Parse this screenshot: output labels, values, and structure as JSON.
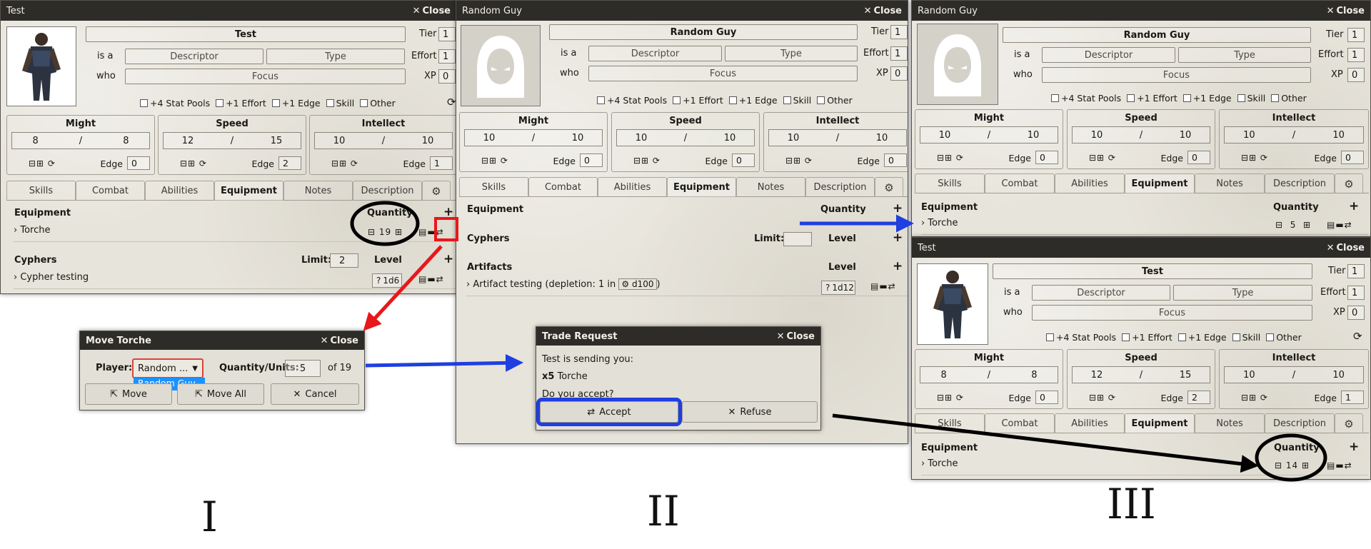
{
  "left_sheet": {
    "title": "Test",
    "close_label": "Close",
    "name": "Test",
    "tier_label": "Tier",
    "tier": "1",
    "effort_label": "Effort",
    "effort": "1",
    "xp_label": "XP",
    "xp": "0",
    "is_a_label": "is a",
    "who_label": "who",
    "descriptor": "Descriptor",
    "type": "Type",
    "focus": "Focus",
    "checks": [
      "+4 Stat Pools",
      "+1 Effort",
      "+1 Edge",
      "Skill",
      "Other"
    ],
    "pools": [
      {
        "name": "Might",
        "value": "8",
        "max": "8",
        "edge": "0"
      },
      {
        "name": "Speed",
        "value": "12",
        "max": "15",
        "edge": "2"
      },
      {
        "name": "Intellect",
        "value": "10",
        "max": "10",
        "edge": "1"
      }
    ],
    "edge_label": "Edge",
    "slash": "/",
    "tabs": [
      "Skills",
      "Combat",
      "Abilities",
      "Equipment",
      "Notes",
      "Description"
    ],
    "equipment_label": "Equipment",
    "quantity_label": "Quantity",
    "item": "Torche",
    "item_qty": "19",
    "cyphers_label": "Cyphers",
    "limit_label": "Limit:",
    "limit_value": "2",
    "level_label": "Level",
    "cypher_item": "Cypher testing",
    "cypher_level": "1d6"
  },
  "move_dialog": {
    "title": "Move Torche",
    "close_label": "Close",
    "player_label": "Player:",
    "player_value": "Random ...",
    "player_option": "Random Guy",
    "qty_label": "Quantity/Units:",
    "qty_value": "5",
    "of_label": "of 19",
    "move_label": "Move",
    "move_all_label": "Move All",
    "cancel_label": "Cancel"
  },
  "middle_sheet": {
    "title": "Random Guy",
    "close_label": "Close",
    "name": "Random Guy",
    "tier_label": "Tier",
    "tier": "1",
    "effort_label": "Effort",
    "effort": "1",
    "xp_label": "XP",
    "xp": "0",
    "is_a_label": "is a",
    "who_label": "who",
    "descriptor": "Descriptor",
    "type": "Type",
    "focus": "Focus",
    "checks": [
      "+4 Stat Pools",
      "+1 Effort",
      "+1 Edge",
      "Skill",
      "Other"
    ],
    "pools": [
      {
        "name": "Might",
        "value": "10",
        "max": "10",
        "edge": "0"
      },
      {
        "name": "Speed",
        "value": "10",
        "max": "10",
        "edge": "0"
      },
      {
        "name": "Intellect",
        "value": "10",
        "max": "10",
        "edge": "0"
      }
    ],
    "edge_label": "Edge",
    "slash": "/",
    "tabs": [
      "Skills",
      "Combat",
      "Abilities",
      "Equipment",
      "Notes",
      "Description"
    ],
    "equipment_label": "Equipment",
    "quantity_label": "Quantity",
    "cyphers_label": "Cyphers",
    "limit_label": "Limit:",
    "level_label": "Level",
    "artifacts_label": "Artifacts",
    "artifact_item": "Artifact testing (depletion: 1 in",
    "artifact_die": "d100",
    "artifact_level": "1d12"
  },
  "trade_dialog": {
    "title": "Trade Request",
    "close_label": "Close",
    "line1": "Test is sending you:",
    "qty": "x5",
    "item": "Torche",
    "question": "Do you accept?",
    "accept_label": "Accept",
    "refuse_label": "Refuse"
  },
  "right_top_sheet": {
    "title": "Random Guy",
    "close_label": "Close",
    "name": "Random Guy",
    "tier_label": "Tier",
    "tier": "1",
    "effort_label": "Effort",
    "effort": "1",
    "xp_label": "XP",
    "xp": "0",
    "is_a_label": "is a",
    "who_label": "who",
    "descriptor": "Descriptor",
    "type": "Type",
    "focus": "Focus",
    "checks": [
      "+4 Stat Pools",
      "+1 Effort",
      "+1 Edge",
      "Skill",
      "Other"
    ],
    "pools": [
      {
        "name": "Might",
        "value": "10",
        "max": "10",
        "edge": "0"
      },
      {
        "name": "Speed",
        "value": "10",
        "max": "10",
        "edge": "0"
      },
      {
        "name": "Intellect",
        "value": "10",
        "max": "10",
        "edge": "0"
      }
    ],
    "edge_label": "Edge",
    "slash": "/",
    "tabs": [
      "Skills",
      "Combat",
      "Abilities",
      "Equipment",
      "Notes",
      "Description"
    ],
    "equipment_label": "Equipment",
    "quantity_label": "Quantity",
    "item": "Torche",
    "item_qty": "5"
  },
  "right_bottom_sheet": {
    "title": "Test",
    "close_label": "Close",
    "name": "Test",
    "tier_label": "Tier",
    "tier": "1",
    "effort_label": "Effort",
    "effort": "1",
    "xp_label": "XP",
    "xp": "0",
    "is_a_label": "is a",
    "who_label": "who",
    "descriptor": "Descriptor",
    "type": "Type",
    "focus": "Focus",
    "checks": [
      "+4 Stat Pools",
      "+1 Effort",
      "+1 Edge",
      "Skill",
      "Other"
    ],
    "pools": [
      {
        "name": "Might",
        "value": "8",
        "max": "8",
        "edge": "0"
      },
      {
        "name": "Speed",
        "value": "12",
        "max": "15",
        "edge": "2"
      },
      {
        "name": "Intellect",
        "value": "10",
        "max": "10",
        "edge": "1"
      }
    ],
    "edge_label": "Edge",
    "slash": "/",
    "tabs": [
      "Skills",
      "Combat",
      "Abilities",
      "Equipment",
      "Notes",
      "Description"
    ],
    "equipment_label": "Equipment",
    "quantity_label": "Quantity",
    "item": "Torche",
    "item_qty": "14"
  },
  "step_labels": [
    "I",
    "II",
    "III"
  ],
  "colors": {
    "title_bar": "#2e2c28",
    "sheet_bg": "#e7e4db",
    "arrow_red": "#e8171b",
    "arrow_blue": "#1f3fe0",
    "arrow_black": "#000000",
    "select_blue": "#1e90ff"
  },
  "icons": [
    "close-icon",
    "plus-icon",
    "minus-icon",
    "refresh-icon",
    "gear-icon",
    "transfer-icon",
    "note-icon",
    "trash-icon",
    "chevron-right-icon",
    "external-link-icon",
    "check-icon"
  ]
}
